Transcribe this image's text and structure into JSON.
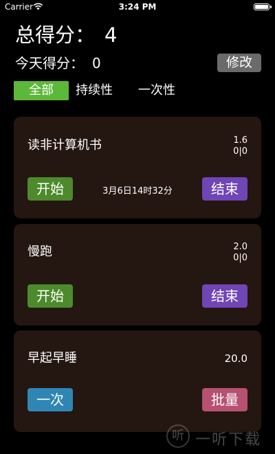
{
  "status_bar": {
    "carrier": "Carrier",
    "time": "3:24 PM"
  },
  "header": {
    "total_label": "总得分：",
    "total_value": "4",
    "today_label": "今天得分：",
    "today_value": "0",
    "edit_label": "修改"
  },
  "tabs": [
    {
      "label": "全部",
      "active": true
    },
    {
      "label": "持续性",
      "active": false
    },
    {
      "label": "一次性",
      "active": false
    }
  ],
  "cards": [
    {
      "title": "读非计算机书",
      "score": "1.6",
      "ratio": "0|0",
      "left_btn": "开始",
      "right_btn": "结束",
      "time": "3月6日14时32分"
    },
    {
      "title": "慢跑",
      "score": "2.0",
      "ratio": "0|0",
      "left_btn": "开始",
      "right_btn": "结束",
      "time": ""
    },
    {
      "title": "早起早睡",
      "score": "20.0",
      "ratio": "",
      "left_btn": "一次",
      "right_btn": "批量",
      "time": ""
    }
  ],
  "watermark": {
    "logo_char": "听",
    "text": "一听下载"
  },
  "colors": {
    "accent_green": "#5cb83a",
    "start_green": "#4d8a2b",
    "end_purple": "#7045b5",
    "once_blue": "#2f86b5",
    "batch_pink": "#b65171",
    "card_bg": "#241611"
  },
  "icons": [
    "wifi-icon",
    "battery-icon"
  ]
}
